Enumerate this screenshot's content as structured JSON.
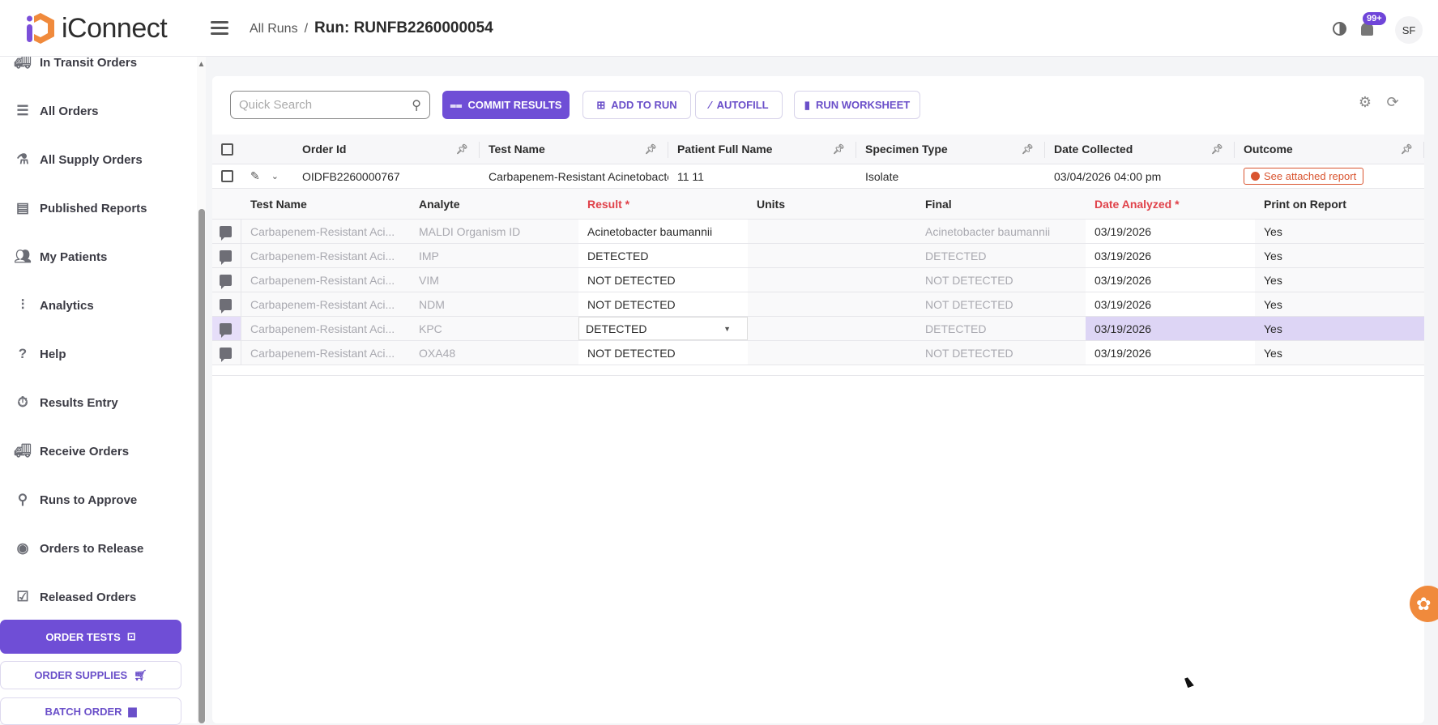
{
  "app": {
    "name": "iConnect",
    "colors": {
      "accent": "#6f4ed6",
      "logo_orange": "#f08a3c",
      "error": "#d9542f"
    }
  },
  "header": {
    "breadcrumb_parent": "All Runs",
    "breadcrumb_separator": "/",
    "title": "Run: RUNFB2260000054",
    "notification_badge": "99+",
    "avatar_initials": "SF"
  },
  "sidebar": {
    "items": [
      {
        "label": "In Transit Orders",
        "icon": "truck-icon"
      },
      {
        "label": "All Orders",
        "icon": "list-icon"
      },
      {
        "label": "All Supply Orders",
        "icon": "supplies-icon"
      },
      {
        "label": "Published Reports",
        "icon": "document-icon"
      },
      {
        "label": "My Patients",
        "icon": "people-icon"
      },
      {
        "label": "Analytics",
        "icon": "analytics-icon"
      },
      {
        "label": "Help",
        "icon": "help-icon"
      },
      {
        "label": "Results Entry",
        "icon": "stopwatch-icon"
      },
      {
        "label": "Receive Orders",
        "icon": "truck-icon"
      },
      {
        "label": "Runs to Approve",
        "icon": "stamp-icon"
      },
      {
        "label": "Orders to Release",
        "icon": "release-icon"
      },
      {
        "label": "Released Orders",
        "icon": "clipboard-check-icon"
      }
    ],
    "buttons": {
      "order_tests": "ORDER TESTS",
      "order_supplies": "ORDER SUPPLIES",
      "batch_order": "BATCH ORDER"
    }
  },
  "toolbar": {
    "search_placeholder": "Quick Search",
    "commit": "COMMIT RESULTS",
    "add_to_run": "ADD TO RUN",
    "autofill": "AUTOFILL",
    "run_worksheet": "RUN WORKSHEET"
  },
  "grid": {
    "columns": [
      "Order Id",
      "Test Name",
      "Patient Full Name",
      "Specimen Type",
      "Date Collected",
      "Outcome"
    ],
    "row": {
      "order_id": "OIDFB2260000767",
      "test_name": "Carbapenem-Resistant Acinetobacter",
      "patient": "11 11",
      "specimen": "Isolate",
      "date_collected": "03/04/2026 04:00 pm",
      "outcome": "See attached report"
    },
    "sub_columns": [
      "Test Name",
      "Analyte",
      "Result *",
      "Units",
      "Final",
      "Date Analyzed *",
      "Print on Report"
    ],
    "sub_rows": [
      {
        "test": "Carbapenem-Resistant Aci...",
        "analyte": "MALDI Organism ID",
        "result": "Acinetobacter baumannii",
        "units": "",
        "final": "Acinetobacter baumannii",
        "date": "03/19/2026",
        "print": "Yes"
      },
      {
        "test": "Carbapenem-Resistant Aci...",
        "analyte": "IMP",
        "result": "DETECTED",
        "units": "",
        "final": "DETECTED",
        "date": "03/19/2026",
        "print": "Yes"
      },
      {
        "test": "Carbapenem-Resistant Aci...",
        "analyte": "VIM",
        "result": "NOT DETECTED",
        "units": "",
        "final": "NOT DETECTED",
        "date": "03/19/2026",
        "print": "Yes"
      },
      {
        "test": "Carbapenem-Resistant Aci...",
        "analyte": "NDM",
        "result": "NOT DETECTED",
        "units": "",
        "final": "NOT DETECTED",
        "date": "03/19/2026",
        "print": "Yes"
      },
      {
        "test": "Carbapenem-Resistant Aci...",
        "analyte": "KPC",
        "result": "DETECTED",
        "units": "",
        "final": "DETECTED",
        "date": "03/19/2026",
        "print": "Yes",
        "selected": true
      },
      {
        "test": "Carbapenem-Resistant Aci...",
        "analyte": "OXA48",
        "result": "NOT DETECTED",
        "units": "",
        "final": "NOT DETECTED",
        "date": "03/19/2026",
        "print": "Yes"
      }
    ]
  }
}
